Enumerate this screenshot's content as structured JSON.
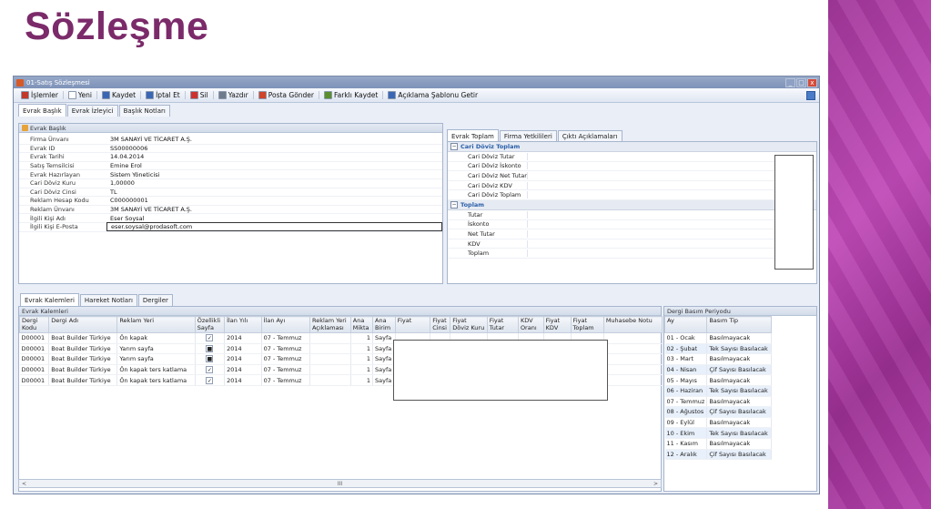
{
  "slide": {
    "title": "Sözleşme"
  },
  "window": {
    "title": "01-Satış Sözleşmesi",
    "min": "_",
    "max": "□",
    "close": "x"
  },
  "toolbar": {
    "items": [
      {
        "label": "İşlemler",
        "icon": "menu-icon",
        "color": "#c0392b"
      },
      {
        "label": "Yeni",
        "icon": "new-document-icon",
        "color": "#ffffff"
      },
      {
        "label": "Kaydet",
        "icon": "save-icon",
        "color": "#3a67b5"
      },
      {
        "label": "İptal Et",
        "icon": "undo-icon",
        "color": "#3a67b5"
      },
      {
        "label": "Sil",
        "icon": "delete-icon",
        "color": "#d0312d"
      },
      {
        "label": "Yazdır",
        "icon": "print-icon",
        "color": "#6f7b8c"
      },
      {
        "label": "Posta Gönder",
        "icon": "mail-icon",
        "color": "#d0452a"
      },
      {
        "label": "Farklı Kaydet",
        "icon": "save-as-icon",
        "color": "#5a8f2a"
      },
      {
        "label": "Açıklama Şablonu Getir",
        "icon": "template-icon",
        "color": "#3a67b5"
      }
    ]
  },
  "top_tabs": [
    "Evrak Başlık",
    "Evrak İzleyici",
    "Başlık Notları"
  ],
  "header_panel": {
    "title": "Evrak Başlık",
    "fields": [
      {
        "label": "Firma Ünvanı",
        "value": "3M SANAYİ VE TİCARET A.Ş."
      },
      {
        "label": "Evrak ID",
        "value": "SS00000006"
      },
      {
        "label": "Evrak Tarihi",
        "value": "14.04.2014"
      },
      {
        "label": "Satış Temsilcisi",
        "value": "Emine Erol"
      },
      {
        "label": "Evrak Hazırlayan",
        "value": "Sistem Yöneticisi"
      },
      {
        "label": "Cari Döviz Kuru",
        "value": "1,00000"
      },
      {
        "label": "Cari Döviz Cinsi",
        "value": "TL"
      },
      {
        "label": "Reklam Hesap Kodu",
        "value": "C000000001"
      },
      {
        "label": "Reklam Ünvanı",
        "value": "3M SANAYİ VE TİCARET A.Ş."
      },
      {
        "label": "İlgili Kişi Adı",
        "value": "Eser Soysal"
      },
      {
        "label": "İlgili Kişi E-Posta",
        "value": "eser.soysal@prodasoft.com"
      }
    ]
  },
  "right_tabs": [
    "Evrak Toplam",
    "Firma Yetkilileri",
    "Çıktı Açıklamaları"
  ],
  "totals": {
    "group1": "Cari Döviz Toplam",
    "group1_rows": [
      "Cari Döviz Tutar",
      "Cari Döviz İskonto",
      "Cari Döviz Net Tutar",
      "Cari Döviz KDV",
      "Cari Döviz Toplam"
    ],
    "group2": "Toplam",
    "group2_rows": [
      "Tutar",
      "İskonto",
      "Net Tutar",
      "KDV",
      "Toplam"
    ]
  },
  "bottom_tabs": [
    "Evrak Kalemleri",
    "Hareket Notları",
    "Dergiler"
  ],
  "items_panel": {
    "title": "Evrak Kalemleri",
    "columns": [
      "Dergi Kodu",
      "Dergi Adı",
      "Reklam Yeri",
      "Özellikli Sayfa",
      "İlan Yılı",
      "İlan Ayı",
      "Reklam Yeri Açıklaması",
      "Ana Mikta",
      "Ana Birim",
      "Fiyat",
      "Fiyat Cinsi",
      "Fiyat Döviz Kuru",
      "Fiyat Tutar",
      "KDV Oranı",
      "Fiyat KDV",
      "Fiyat Toplam",
      "Muhasebe Notu"
    ],
    "rows": [
      {
        "kod": "D00001",
        "ad": "Boat Builder Türkiye",
        "yer": "Ön kapak",
        "ozel": "✓",
        "yil": "2014",
        "ay": "07 - Temmuz",
        "miktar": "1",
        "birim": "Sayfa"
      },
      {
        "kod": "D00001",
        "ad": "Boat Builder Türkiye",
        "yer": "Yarım sayfa",
        "ozel": "■",
        "yil": "2014",
        "ay": "07 - Temmuz",
        "miktar": "1",
        "birim": "Sayfa"
      },
      {
        "kod": "D00001",
        "ad": "Boat Builder Türkiye",
        "yer": "Yarım sayfa",
        "ozel": "■",
        "yil": "2014",
        "ay": "07 - Temmuz",
        "miktar": "1",
        "birim": "Sayfa"
      },
      {
        "kod": "D00001",
        "ad": "Boat Builder Türkiye",
        "yer": "Ön kapak  ters katlama",
        "ozel": "✓",
        "yil": "2014",
        "ay": "07 - Temmuz",
        "miktar": "1",
        "birim": "Sayfa"
      },
      {
        "kod": "D00001",
        "ad": "Boat Builder Türkiye",
        "yer": "Ön kapak  ters katlama",
        "ozel": "✓",
        "yil": "2014",
        "ay": "07 - Temmuz",
        "miktar": "1",
        "birim": "Sayfa"
      }
    ],
    "scroll_mid": "III",
    "scroll_left": "<",
    "scroll_right": ">"
  },
  "period_panel": {
    "title": "Dergi Basım Periyodu",
    "columns": [
      "Ay",
      "Basım Tip"
    ],
    "rows": [
      {
        "ay": "01 - Ocak",
        "tip": "Basılmayacak"
      },
      {
        "ay": "02 - Şubat",
        "tip": "Tek Sayısı Basılacak"
      },
      {
        "ay": "03 - Mart",
        "tip": "Basılmayacak"
      },
      {
        "ay": "04 - Nisan",
        "tip": "Çif Sayısı Basılacak"
      },
      {
        "ay": "05 - Mayıs",
        "tip": "Basılmayacak"
      },
      {
        "ay": "06 - Haziran",
        "tip": "Tek Sayısı Basılacak"
      },
      {
        "ay": "07 - Temmuz",
        "tip": "Basılmayacak"
      },
      {
        "ay": "08 - Ağustos",
        "tip": "Çif Sayısı Basılacak"
      },
      {
        "ay": "09 - Eylül",
        "tip": "Basılmayacak"
      },
      {
        "ay": "10 - Ekim",
        "tip": "Tek Sayısı Basılacak"
      },
      {
        "ay": "11 - Kasım",
        "tip": "Basılmayacak"
      },
      {
        "ay": "12 - Aralık",
        "tip": "Çif Sayısı Basılacak"
      }
    ]
  }
}
